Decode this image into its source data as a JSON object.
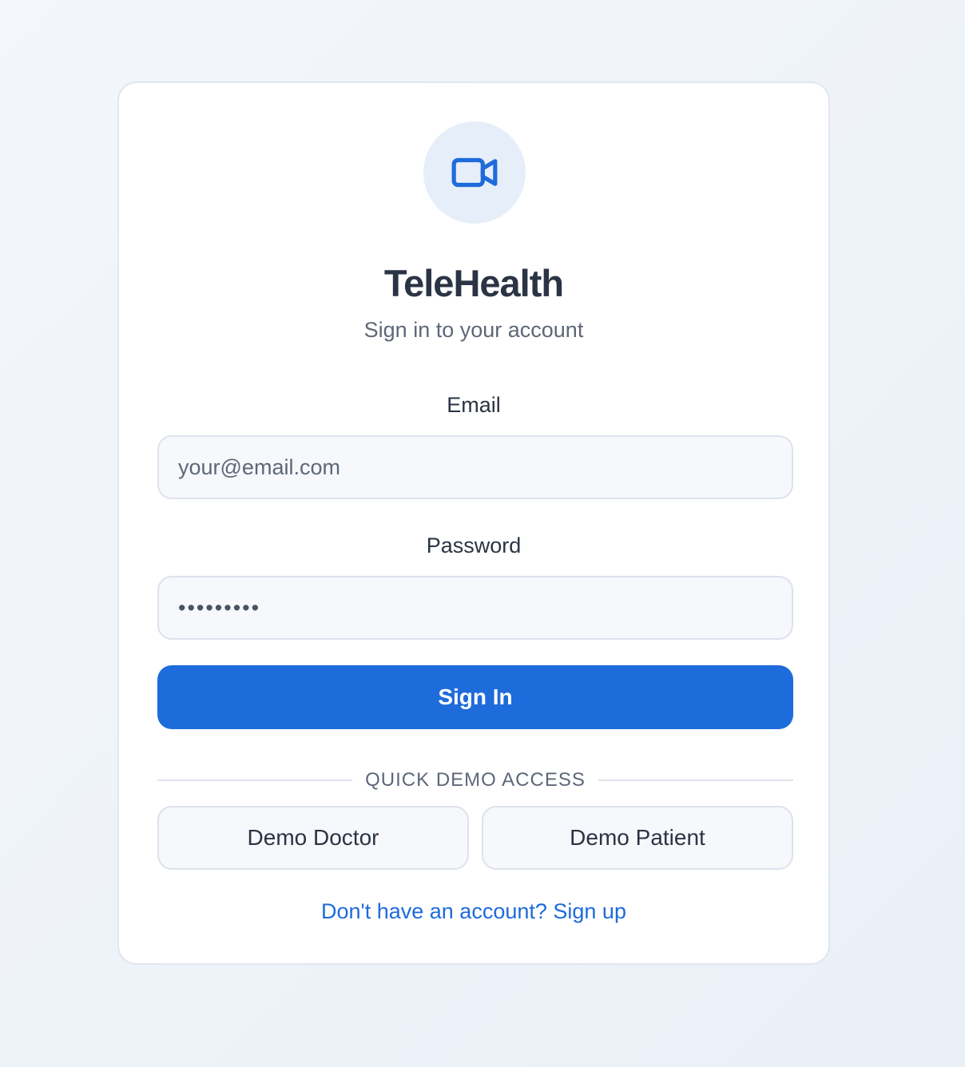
{
  "brand": {
    "name": "TeleHealth",
    "icon": "video-camera-icon",
    "accent_color": "#1e6bdb",
    "icon_bg_color": "#e6eef9"
  },
  "login": {
    "subtitle": "Sign in to your account",
    "email_label": "Email",
    "email_placeholder": "your@email.com",
    "email_value": "",
    "password_label": "Password",
    "password_value": "•••••••••",
    "submit_label": "Sign In"
  },
  "demo": {
    "divider_label": "QUICK DEMO ACCESS",
    "doctor_label": "Demo Doctor",
    "patient_label": "Demo Patient"
  },
  "footer": {
    "signup_link": "Don't have an account? Sign up"
  }
}
